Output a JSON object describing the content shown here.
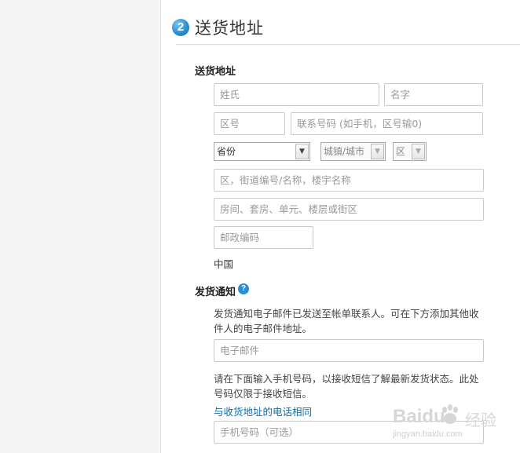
{
  "step": {
    "number": "2",
    "title": "送货地址"
  },
  "shipping_address": {
    "heading": "送货地址",
    "last_name_placeholder": "姓氏",
    "first_name_placeholder": "名字",
    "area_code_placeholder": "区号",
    "phone_placeholder": "联系号码 (如手机，区号输0)",
    "province_select": "省份",
    "city_select": "城镇/城市",
    "district_select": "区",
    "street_placeholder": "区，街道编号/名称，楼宇名称",
    "unit_placeholder": "房间、套房、单元、楼层或街区",
    "postal_placeholder": "邮政编码",
    "country": "中国"
  },
  "shipping_notice": {
    "heading": "发货通知",
    "help_icon": "?",
    "email_note": "发货通知电子邮件已发送至帐单联系人。可在下方添加其他收件人的电子邮件地址。",
    "email_placeholder": "电子邮件",
    "sms_note": "请在下面输入手机号码，以接收短信了解最新发货状态。此处号码仅限于接收短信。",
    "same_phone_link": "与收货地址的电话相同",
    "mobile_placeholder": "手机号码（可选）"
  },
  "watermark": {
    "brand": "Baidu",
    "brand_cn": "经验",
    "url": "jingyan.baidu.com"
  }
}
